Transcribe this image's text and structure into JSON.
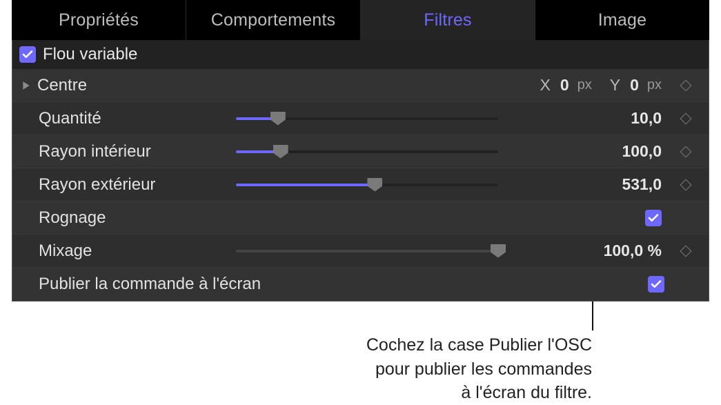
{
  "tabs": {
    "properties": "Propriétés",
    "behaviors": "Comportements",
    "filters": "Filtres",
    "image": "Image"
  },
  "section": {
    "title": "Flou variable"
  },
  "rows": {
    "centre": {
      "label": "Centre",
      "x_label": "X",
      "x_value": "0",
      "x_unit": "px",
      "y_label": "Y",
      "y_value": "0",
      "y_unit": "px"
    },
    "quantite": {
      "label": "Quantité",
      "value": "10,0"
    },
    "rayon_int": {
      "label": "Rayon intérieur",
      "value": "100,0"
    },
    "rayon_ext": {
      "label": "Rayon extérieur",
      "value": "531,0"
    },
    "rognage": {
      "label": "Rognage"
    },
    "mixage": {
      "label": "Mixage",
      "value": "100,0 %"
    },
    "publier": {
      "label": "Publier la commande à l'écran"
    }
  },
  "annotation": {
    "line1": "Cochez la case Publier l'OSC",
    "line2": "pour publier les commandes",
    "line3": "à l'écran du filtre."
  }
}
